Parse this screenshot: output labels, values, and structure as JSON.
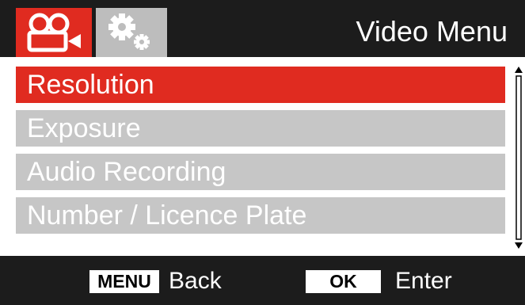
{
  "header": {
    "title": "Video Menu",
    "tabs": [
      {
        "name": "video",
        "icon": "video-camera-icon",
        "active": true
      },
      {
        "name": "settings",
        "icon": "gears-icon",
        "active": false
      }
    ]
  },
  "menu": {
    "items": [
      {
        "label": "Resolution",
        "selected": true
      },
      {
        "label": "Exposure",
        "selected": false
      },
      {
        "label": "Audio Recording",
        "selected": false
      },
      {
        "label": "Number / Licence Plate",
        "selected": false
      }
    ]
  },
  "footer": {
    "menu_key": "MENU",
    "back_label": "Back",
    "ok_key": "OK",
    "enter_label": "Enter"
  },
  "colors": {
    "accent": "#e02b20",
    "inactive": "#c6c6c6",
    "bar": "#1c1c1c"
  }
}
